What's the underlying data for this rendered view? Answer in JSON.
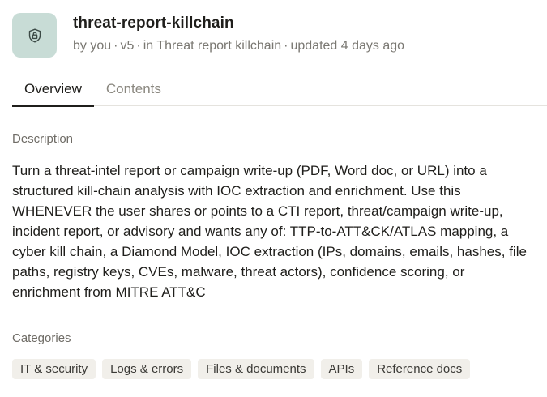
{
  "header": {
    "icon": "lock-shield-icon",
    "title": "threat-report-killchain",
    "meta": {
      "author": "by you",
      "version": "v5",
      "location_prefix": "in",
      "location": "Threat report killchain",
      "updated": "updated 4 days ago",
      "separator": "·"
    }
  },
  "tabs": [
    {
      "label": "Overview",
      "active": true
    },
    {
      "label": "Contents",
      "active": false
    }
  ],
  "description": {
    "label": "Description",
    "text": "Turn a threat-intel report or campaign write-up (PDF, Word doc, or URL) into a structured kill-chain analysis with IOC extraction and enrichment. Use this WHENEVER the user shares or points to a CTI report, threat/campaign write-up, incident report, or advisory and wants any of: TTP-to-ATT&CK/ATLAS mapping, a cyber kill chain, a Diamond Model, IOC extraction (IPs, domains, emails, hashes, file paths, registry keys, CVEs, malware, threat actors), confidence scoring, or enrichment from MITRE ATT&C"
  },
  "categories": {
    "label": "Categories",
    "items": [
      "IT & security",
      "Logs & errors",
      "Files & documents",
      "APIs",
      "Reference docs"
    ]
  },
  "colors": {
    "icon_bg": "#c8dcd6",
    "text_primary": "#1f1e1b",
    "text_muted": "#7a7872",
    "chip_bg": "#f1efea",
    "divider": "#e5e3de"
  }
}
